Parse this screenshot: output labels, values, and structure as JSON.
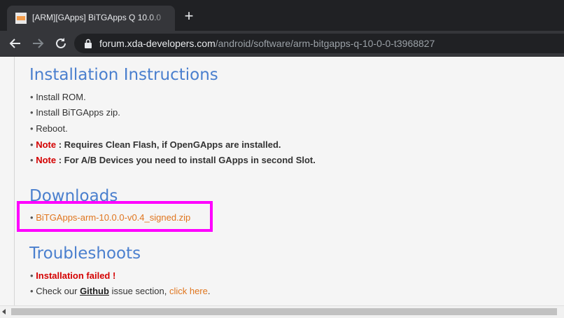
{
  "tab": {
    "title": "[ARM][GApps] BiTGApps Q 10.0.0"
  },
  "toolbar": {
    "url_host": "forum.xda-developers.com",
    "url_path": "/android/software/arm-bitgapps-q-10-0-0-t3968827"
  },
  "sections": {
    "install": {
      "heading": "Installation Instructions",
      "items": [
        "Install ROM.",
        "Install BiTGApps zip.",
        "Reboot."
      ],
      "notes": [
        {
          "label": "Note",
          "text": " : Requires Clean Flash, if OpenGApps are installed."
        },
        {
          "label": "Note",
          "text": " : For A/B Devices you need to install GApps in second Slot."
        }
      ]
    },
    "downloads": {
      "heading": "Downloads",
      "file": "BiTGApps-arm-10.0.0-v0.4_signed.zip"
    },
    "troubleshoots": {
      "heading": "Troubleshoots",
      "error": "Installation failed !",
      "check_prefix": "Check our ",
      "github": "Github",
      "check_middle": " issue section, ",
      "click": "click here",
      "check_suffix": "."
    }
  },
  "bullet": "•",
  "colors": {
    "heading": "#4a7fce",
    "note": "#d40000",
    "link": "#e0761f",
    "highlight": "#ff00ff"
  }
}
